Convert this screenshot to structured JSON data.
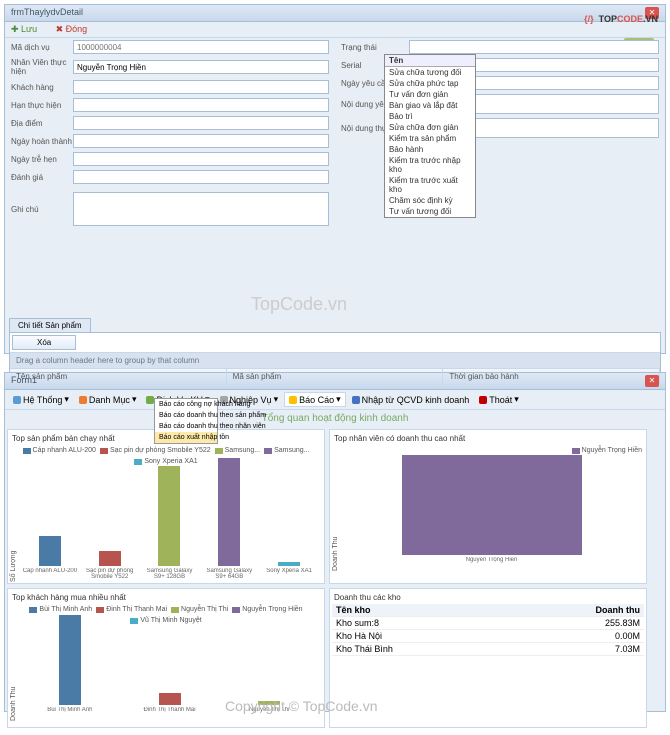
{
  "logo": {
    "brace": "{/}",
    "top": "TOP",
    "code": "CODE",
    "vn": ".VN"
  },
  "watermark": "TopCode.vn",
  "copyright": "Copyright © TopCode.vn",
  "panel1": {
    "title": "frmThaylydvDetail",
    "toolbar": {
      "save": "Lưu",
      "close": "Đóng"
    },
    "fields": {
      "madichvu": {
        "label": "Mã dịch vụ",
        "placeholder": "1000000004"
      },
      "nhanvien": {
        "label": "Nhân Viên thực hiện",
        "value": "Nguyễn Trọng Hiền"
      },
      "khachhang": "Khách hàng",
      "hanthuchien": "Hạn thực hiện",
      "diadiem": "Địa điểm",
      "ngayhoanthanh": "Ngày hoàn thành",
      "ngaytrehen": "Ngày trễ hẹn",
      "danhgia": "Đánh giá",
      "ghichu": "Ghi chú",
      "trangthai": "Trạng thái",
      "serial": "Serial",
      "ngayyeucau": "Ngày yêu cầu",
      "noidungyeucau": "Nội dung yêu cầu",
      "noidungthuchien": "Nội dung thực hiện"
    },
    "dropdown": {
      "header": "Tên",
      "items": [
        "Sửa chữa tương đối",
        "Sửa chữa phức tạp",
        "Tư vấn đơn giản",
        "Bàn giao và lắp đặt",
        "Bảo trì",
        "Sửa chữa đơn giản",
        "Kiểm tra sản phẩm",
        "Bảo hành",
        "Kiểm tra trước nhập kho",
        "Kiểm tra trước xuất kho",
        "Chăm sóc định kỳ",
        "Tư vấn tương đối"
      ]
    },
    "detail": {
      "tab": "Chi tiết Sản phẩm",
      "btn": "Xóa",
      "groupby": "Drag a column header here to group by that column",
      "cols": [
        "Tên sản phẩm",
        "Mã sản phẩm",
        "Thời gian bảo hành"
      ]
    }
  },
  "panel2": {
    "title": "Form1",
    "ribbon": [
      {
        "label": "Hệ Thống",
        "color": "#5b9bd5"
      },
      {
        "label": "Danh Mục",
        "color": "#ed7d31"
      },
      {
        "label": "Dịch Vụ KH",
        "color": "#70ad47"
      },
      {
        "label": "Nghiệp Vụ",
        "color": "#a5a5a5"
      },
      {
        "label": "Báo Cáo",
        "color": "#ffc000",
        "active": true
      },
      {
        "label": "Nhập từ QCVD kinh doanh",
        "color": "#4472c4"
      },
      {
        "label": "Thoát",
        "color": "#c00000"
      }
    ],
    "menu": [
      "Báo cáo công nợ khách hàng",
      "Báo cáo doanh thu theo sản phẩm",
      "Báo cáo doanh thu theo nhân viên",
      "Báo cáo xuất nhập tồn"
    ],
    "overview": "Tổng quan hoạt động kinh doanh",
    "charts": {
      "c1": {
        "title": "Top sản phẩm bán chạy nhất",
        "ylabel": "Số Lượng",
        "legend": [
          {
            "label": "Cáp nhanh ALU-200",
            "color": "#4a7ba6"
          },
          {
            "label": "Sạc pin dự phòng Smobile Y522",
            "color": "#b85450"
          },
          {
            "label": "Samsung...",
            "color": "#9fb35a"
          },
          {
            "label": "Samsung...",
            "color": "#80699b"
          },
          {
            "label": "Sony Xperia XA1",
            "color": "#4aacc5"
          }
        ]
      },
      "c2": {
        "title": "Top nhân viên có doanh thu cao nhất",
        "ylabel": "Doanh Thu",
        "legend": [
          {
            "label": "Nguyễn Trọng Hiền",
            "color": "#80699b"
          }
        ],
        "xlabel": "Nguyễn Trọng Hiền"
      },
      "c3": {
        "title": "Top khách hàng mua nhiều nhất",
        "ylabel": "Doanh Thu",
        "legend": [
          {
            "label": "Bùi Thị Minh Anh",
            "color": "#4a7ba6"
          },
          {
            "label": "Đinh Thị Thanh Mai",
            "color": "#b85450"
          },
          {
            "label": "Nguyễn Thị Thi",
            "color": "#9fb35a"
          },
          {
            "label": "Nguyễn Trọng Hiền",
            "color": "#80699b"
          },
          {
            "label": "Vũ Thị Minh Nguyệt",
            "color": "#4aacc5"
          }
        ]
      },
      "c4": {
        "title": "Doanh thu các kho",
        "cols": [
          "Tên kho",
          "Doanh thu"
        ],
        "rows": [
          [
            "Kho sum:8",
            "255.83M"
          ],
          [
            "Kho Hà Nội",
            "0.00M"
          ],
          [
            "Kho Thái Bình",
            "7.03M"
          ]
        ]
      }
    }
  },
  "chart_data": [
    {
      "type": "bar",
      "title": "Top sản phẩm bán chạy nhất",
      "ylabel": "Số Lượng",
      "categories": [
        "Cáp nhanh ALU-200",
        "Sạc pin dự phòng Smobile Y522",
        "Samsung Galaxy S9+ 128GB",
        "Samsung Galaxy S9+ 64GB",
        "Sony Xperia XA1"
      ],
      "values": [
        8,
        4,
        27,
        29,
        1
      ],
      "colors": [
        "#4a7ba6",
        "#b85450",
        "#9fb35a",
        "#80699b",
        "#4aacc5"
      ],
      "ylim": [
        0,
        30
      ]
    },
    {
      "type": "bar",
      "title": "Top nhân viên có doanh thu cao nhất",
      "ylabel": "Doanh Thu",
      "categories": [
        "Nguyễn Trọng Hiền"
      ],
      "values": [
        27000000
      ],
      "colors": [
        "#80699b"
      ],
      "ylim": [
        0,
        30000000
      ],
      "ticks": [
        "0M",
        "5M",
        "10M",
        "15M",
        "20M",
        "25M",
        "30M"
      ]
    },
    {
      "type": "bar",
      "title": "Top khách hàng mua nhiều nhất",
      "ylabel": "Doanh Thu",
      "categories": [
        "Bùi Thị Minh Anh",
        "Đinh Thị Thanh Mai",
        "Nguyễn Thị Thi"
      ],
      "values": [
        240000000,
        30000000,
        5000000
      ],
      "colors": [
        "#4a7ba6",
        "#b85450",
        "#9fb35a"
      ],
      "ylim": [
        0,
        260000000
      ],
      "ticks": [
        "20M",
        "60M",
        "100M",
        "140M",
        "180M",
        "220M",
        "260M"
      ]
    },
    {
      "type": "table",
      "title": "Doanh thu các kho",
      "columns": [
        "Tên kho",
        "Doanh thu"
      ],
      "rows": [
        [
          "Kho sum:8",
          "255.83M"
        ],
        [
          "Kho Hà Nội",
          "0.00M"
        ],
        [
          "Kho Thái Bình",
          "7.03M"
        ]
      ]
    }
  ]
}
